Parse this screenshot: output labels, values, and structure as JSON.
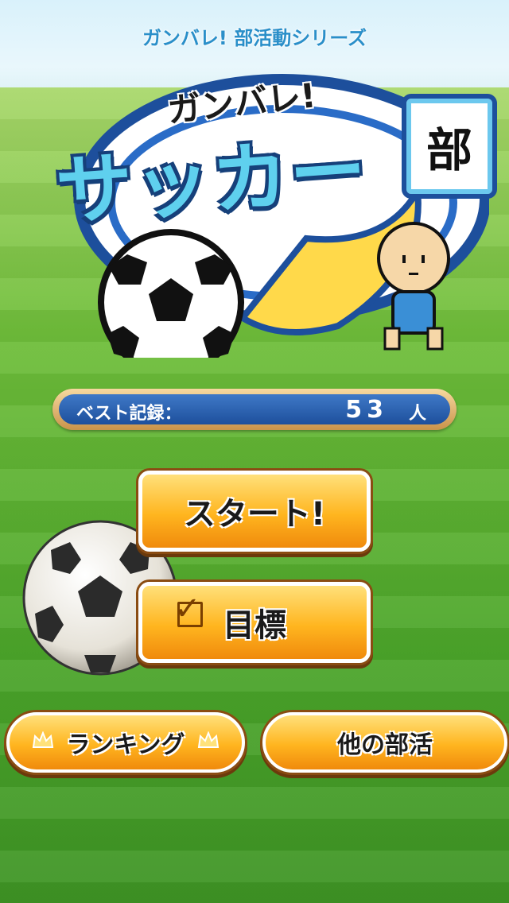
{
  "header": {
    "series_title": "ガンバレ! 部活動シリーズ"
  },
  "logo": {
    "line1": "ガンバレ!",
    "line2": "サッカー",
    "badge": "部"
  },
  "best_record": {
    "label": "ベスト記録：",
    "value": "53",
    "unit": "人"
  },
  "buttons": {
    "start": "スタート!",
    "goal": "目標",
    "ranking": "ランキング",
    "other_clubs": "他の部活"
  },
  "colors": {
    "series_title": "#2a8fc9",
    "button_orange": "#ffb51f",
    "score_bar_blue": "#1d4f9c",
    "field_green": "#4ba52a"
  },
  "icons": {
    "goal_checkbox": "checkbox-icon",
    "ranking_crown": "crown-icon"
  }
}
